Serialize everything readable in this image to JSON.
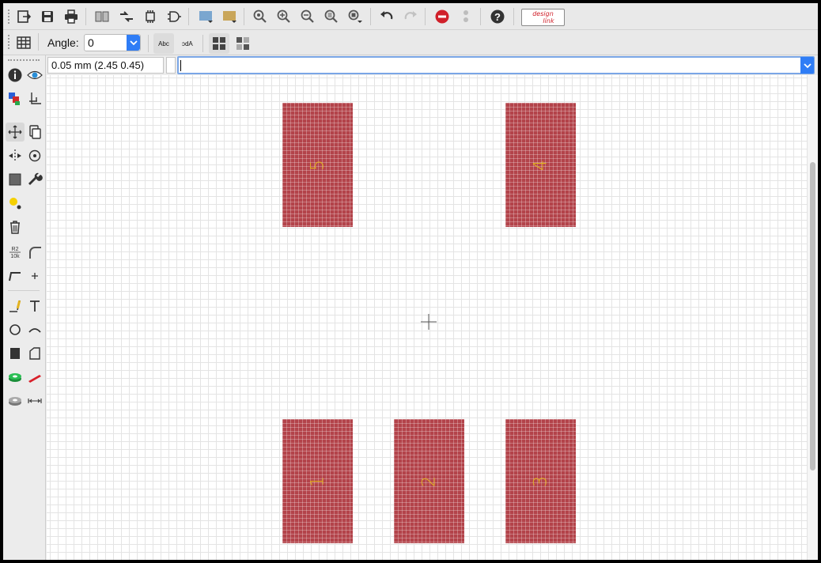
{
  "toolbar": {
    "icons": [
      "open-icon",
      "save-icon",
      "print-icon",
      "book-icon",
      "arrows-icon",
      "chip-icon",
      "gate-icon",
      "scr-icon",
      "ulp-icon",
      "zoom-fit-icon",
      "zoom-in-icon",
      "zoom-out-icon",
      "zoom-select-icon",
      "zoom-last-icon",
      "undo-icon",
      "redo-icon",
      "stop-icon",
      "go-icon",
      "help-icon"
    ],
    "design_link": [
      "design",
      "link"
    ]
  },
  "toolbar2": {
    "angle_label": "Angle:",
    "angle_value": "0",
    "text_abc": "Abc",
    "text_mirror": "Abc"
  },
  "status": {
    "coordinate": "0.05 mm (2.45 0.45)",
    "command": ""
  },
  "canvas": {
    "pads": [
      {
        "label": "5"
      },
      {
        "label": "4"
      },
      {
        "label": "1"
      },
      {
        "label": "2"
      },
      {
        "label": "3"
      }
    ],
    "pad_color": "#b3434a",
    "label_color": "#e3b320"
  },
  "colors": {
    "accent": "#2f7df6",
    "stop": "#d0202a"
  }
}
